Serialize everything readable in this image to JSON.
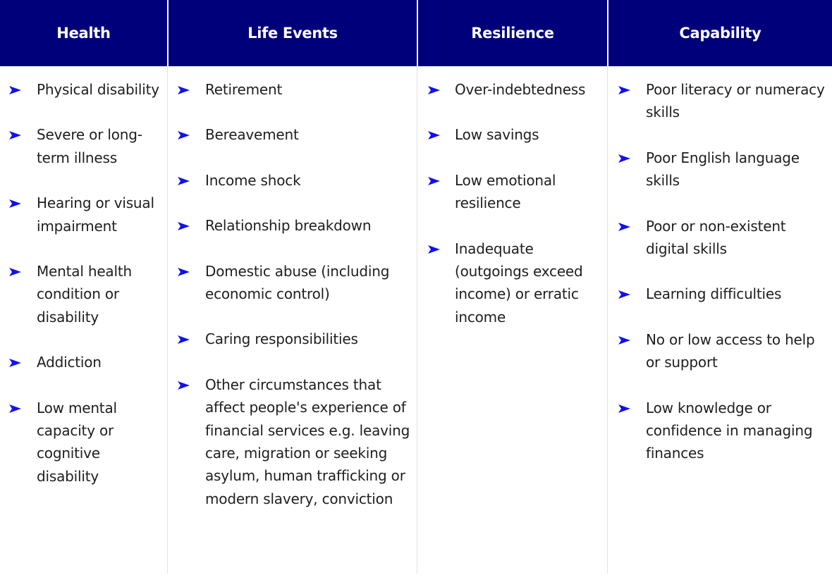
{
  "accent_color": "#00007a",
  "bullet_color": "#1010f0",
  "columns": [
    {
      "title": "Health",
      "items": [
        "Physical disability",
        "Severe or long-term illness",
        "Hearing or visual impairment",
        "Mental health condition or disability",
        "Addiction",
        "Low mental capacity or cognitive disability"
      ]
    },
    {
      "title": "Life Events",
      "items": [
        "Retirement",
        "Bereavement",
        "Income shock",
        "Relationship breakdown",
        "Domestic abuse (including economic control)",
        "Caring responsibilities",
        "Other circumstances that affect people's experience of financial services e.g. leaving care, migration or seeking asylum, human trafficking or modern slavery, conviction"
      ]
    },
    {
      "title": "Resilience",
      "items": [
        "Over-indebtedness",
        "Low savings",
        "Low emotional resilience",
        "Inadequate (outgoings exceed income) or erratic income"
      ]
    },
    {
      "title": "Capability",
      "items": [
        "Poor literacy or numeracy skills",
        "Poor English language skills",
        "Poor or non-existent digital skills",
        "Learning difficulties",
        "No or low access to help or support",
        "Low knowledge or confidence in managing finances"
      ]
    }
  ]
}
